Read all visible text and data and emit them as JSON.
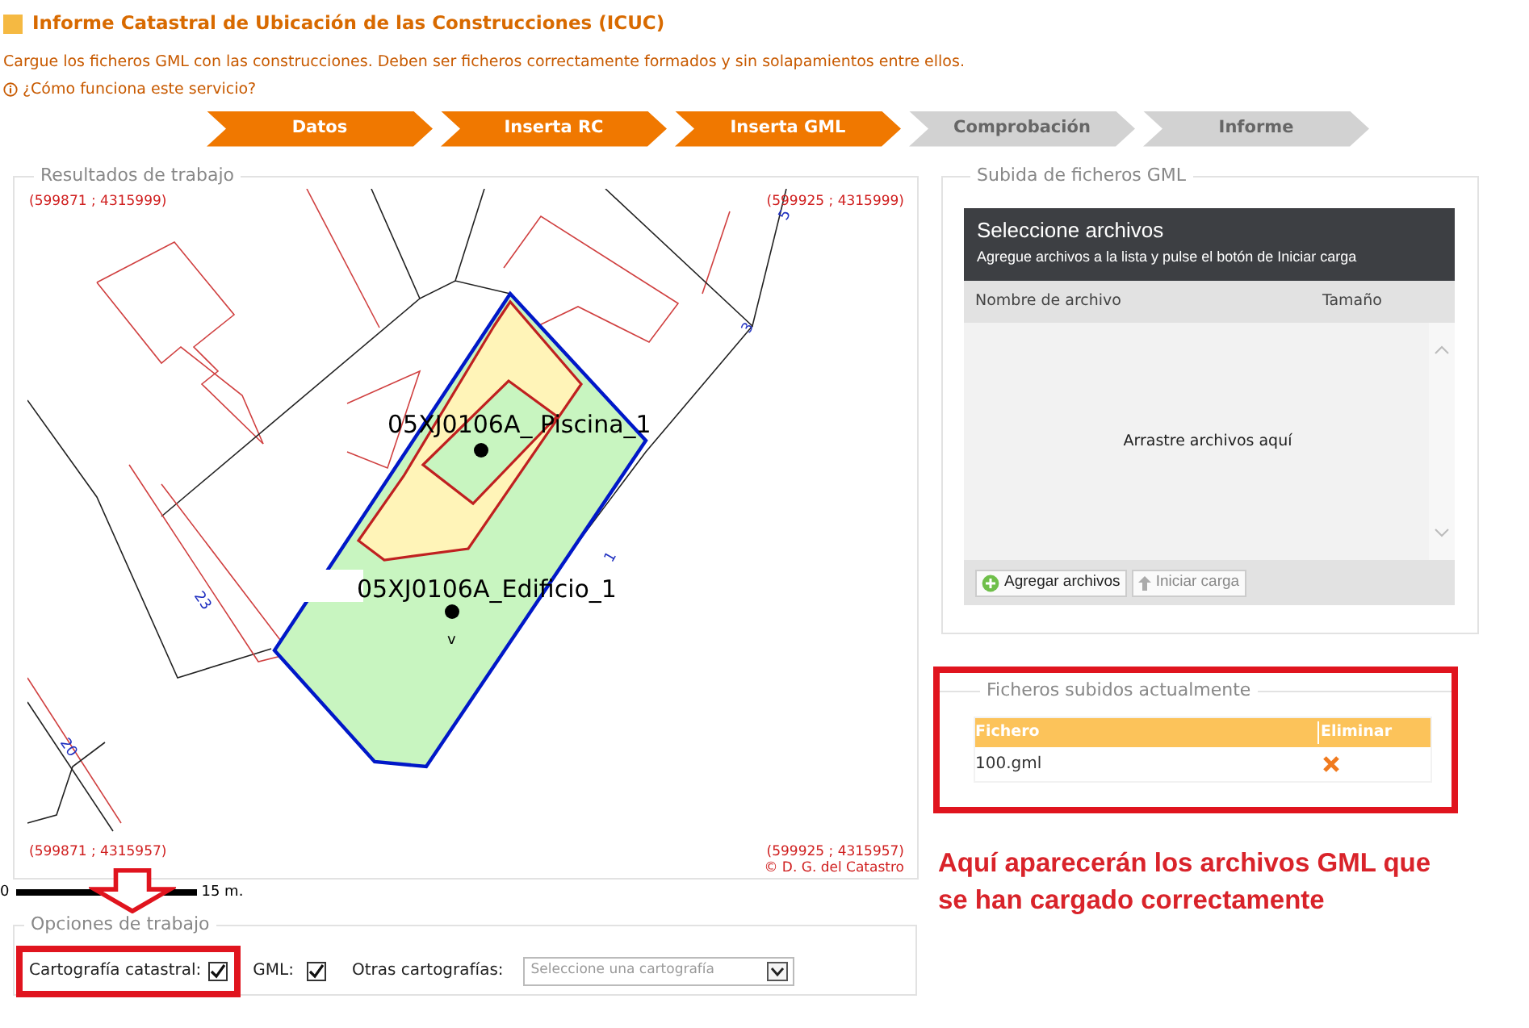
{
  "header": {
    "title": "Informe Catastral de Ubicación de las Construcciones (ICUC)",
    "description": "Cargue los ficheros GML con las construcciones. Deben ser ficheros correctamente formados y sin solapamientos entre ellos.",
    "help_link": "¿Cómo funciona este servicio?"
  },
  "steps": [
    {
      "label": "Datos",
      "completed": true
    },
    {
      "label": "Inserta RC",
      "completed": true
    },
    {
      "label": "Inserta GML",
      "completed": true
    },
    {
      "label": "Comprobación",
      "completed": false
    },
    {
      "label": "Informe",
      "completed": false
    }
  ],
  "results": {
    "legend": "Resultados de trabajo",
    "map": {
      "corner_coordinates": [
        "(599871 ; 4315999)",
        "(599925 ; 4315999)",
        "(599871 ; 4315957)",
        "(599925 ; 4315957)"
      ],
      "copyright": "© D. G. del Catastro",
      "labels": [
        {
          "kind": "feature",
          "text": "05XJ0106A_ Piscina_1"
        },
        {
          "kind": "feature",
          "text": "05XJ0106A_Edificio_1"
        },
        {
          "kind": "mark",
          "text": "v"
        }
      ],
      "parcel_numbers": [
        "5",
        "3",
        "1",
        "23",
        "20"
      ],
      "scale": {
        "start": "0",
        "end": "15 m."
      }
    }
  },
  "options": {
    "legend": "Opciones de trabajo",
    "cadastral": {
      "label": "Cartografía catastral:",
      "checked": true
    },
    "gml": {
      "label": "GML:",
      "checked": true
    },
    "other": {
      "label": "Otras cartografías:",
      "placeholder": "Seleccione una cartografía"
    }
  },
  "upload": {
    "legend": "Subida de ficheros GML",
    "title": "Seleccione archivos",
    "subtitle": "Agregue archivos a la lista y pulse el botón de Iniciar carga",
    "columns": [
      "Nombre de archivo",
      "Tamaño"
    ],
    "drop_hint": "Arrastre archivos aquí",
    "buttons": [
      {
        "label": "Agregar archivos",
        "kind": "add",
        "disabled": false
      },
      {
        "label": "Iniciar carga",
        "kind": "upload",
        "disabled": true
      }
    ]
  },
  "uploaded": {
    "legend": "Ficheros subidos actualmente",
    "columns": [
      "Fichero",
      "Eliminar"
    ],
    "rows": [
      {
        "file": "100.gml"
      }
    ]
  },
  "annotation": "Aquí aparecerán los archivos GML que se han cargado correctamente"
}
